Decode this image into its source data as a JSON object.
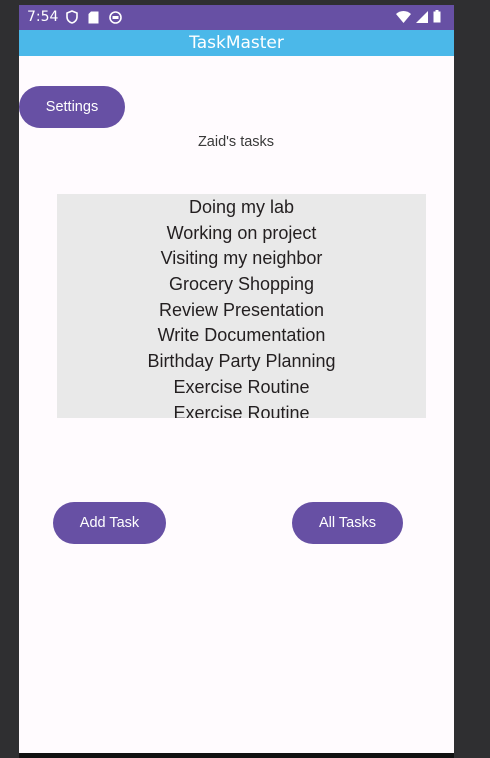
{
  "status_bar": {
    "time": "7:54",
    "left_icons": [
      "shield-icon",
      "sd-card-icon",
      "sync-circle-icon"
    ],
    "right_icons": [
      "wifi-icon",
      "signal-icon",
      "battery-icon"
    ],
    "background_color": "#6750a4"
  },
  "app_bar": {
    "title": "TaskMaster",
    "background_color": "#4bb8e9"
  },
  "buttons": {
    "settings_label": "Settings",
    "add_task_label": "Add Task",
    "all_tasks_label": "All Tasks",
    "color": "#6750a4"
  },
  "user_title": "Zaid's tasks",
  "tasks": [
    "Doing my lab",
    "Working on project",
    "Visiting my neighbor",
    "Grocery Shopping",
    "Review Presentation",
    "Write Documentation",
    "Birthday Party Planning",
    "Exercise Routine",
    "Exercise Routine"
  ]
}
